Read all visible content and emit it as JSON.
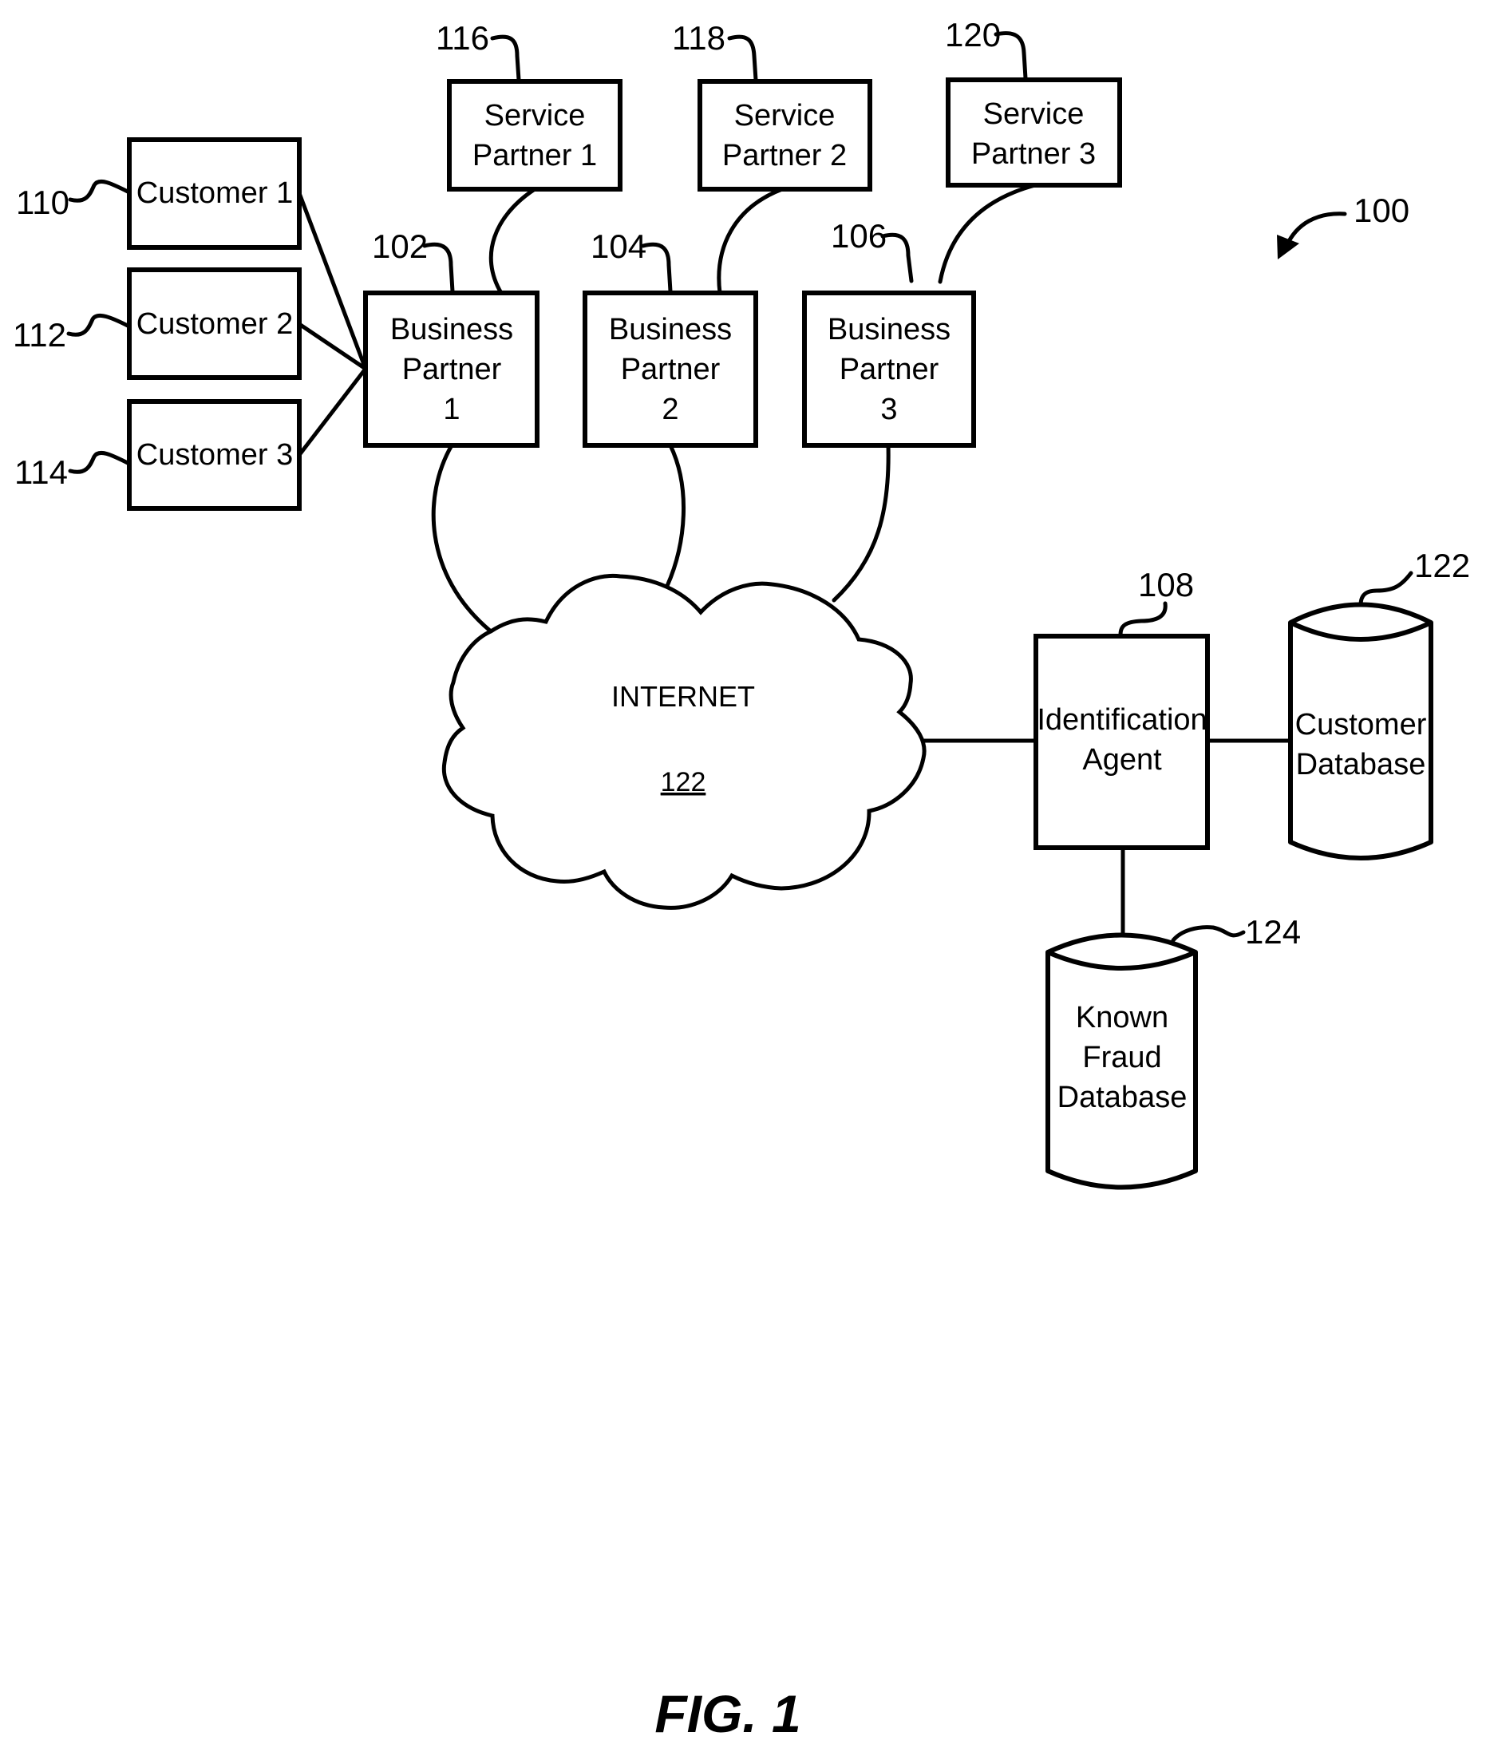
{
  "figure": {
    "caption": "FIG. 1",
    "system_ref": "100"
  },
  "customers": [
    {
      "label": "Customer 1",
      "ref": "110"
    },
    {
      "label": "Customer 2",
      "ref": "112"
    },
    {
      "label": "Customer 3",
      "ref": "114"
    }
  ],
  "business_partners": [
    {
      "line1": "Business",
      "line2": "Partner",
      "line3": "1",
      "ref": "102"
    },
    {
      "line1": "Business",
      "line2": "Partner",
      "line3": "2",
      "ref": "104"
    },
    {
      "line1": "Business",
      "line2": "Partner",
      "line3": "3",
      "ref": "106"
    }
  ],
  "service_partners": [
    {
      "line1": "Service",
      "line2": "Partner 1",
      "ref": "116"
    },
    {
      "line1": "Service",
      "line2": "Partner 2",
      "ref": "118"
    },
    {
      "line1": "Service",
      "line2": "Partner 3",
      "ref": "120"
    }
  ],
  "internet": {
    "label": "INTERNET",
    "ref": "122"
  },
  "identification_agent": {
    "line1": "Identification",
    "line2": "Agent",
    "ref": "108"
  },
  "customer_database": {
    "line1": "Customer",
    "line2": "Database",
    "ref": "122"
  },
  "known_fraud_database": {
    "line1": "Known",
    "line2": "Fraud",
    "line3": "Database",
    "ref": "124"
  }
}
